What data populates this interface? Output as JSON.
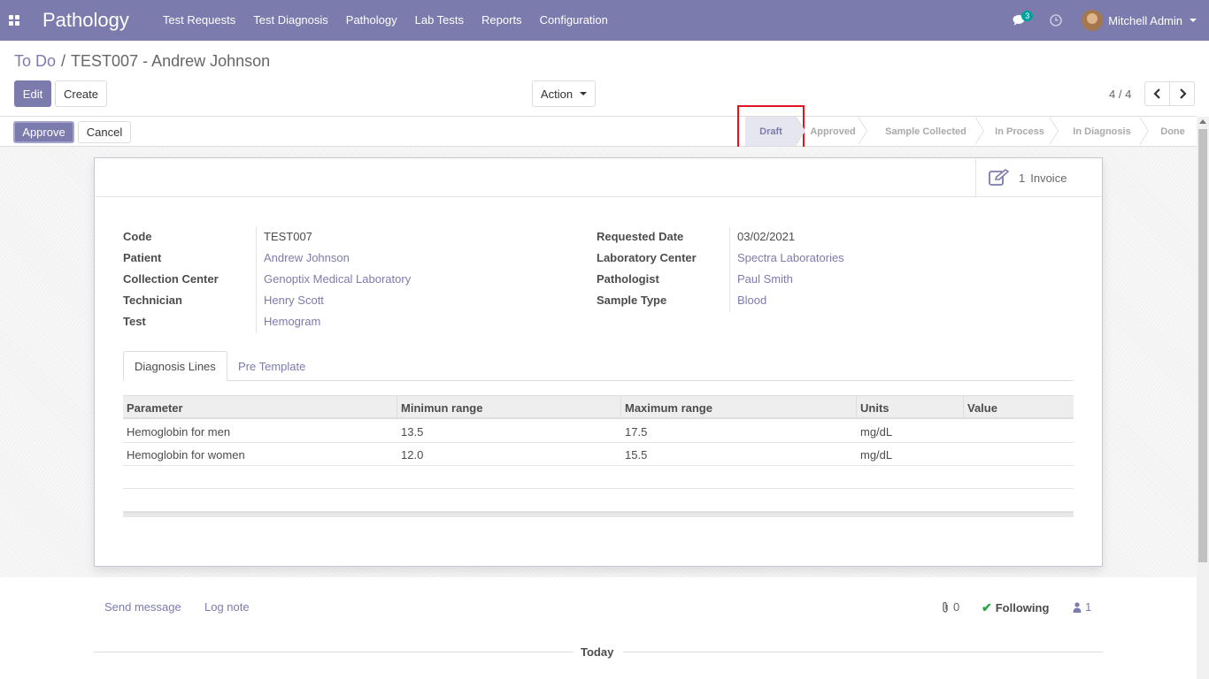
{
  "app": {
    "brand": "Pathology"
  },
  "menu": [
    "Test Requests",
    "Test Diagnosis",
    "Pathology",
    "Lab Tests",
    "Reports",
    "Configuration"
  ],
  "nav": {
    "chat_count": "3",
    "user_name": "Mitchell Admin"
  },
  "breadcrumb": {
    "parent": "To Do",
    "separator": "/",
    "current": "TEST007 - Andrew Johnson"
  },
  "toolbar": {
    "edit_label": "Edit",
    "create_label": "Create",
    "action_label": "Action"
  },
  "pager": {
    "value": "4 / 4"
  },
  "statusbar": {
    "approve_label": "Approve",
    "cancel_label": "Cancel",
    "stages": [
      "Draft",
      "Approved",
      "Sample Collected",
      "In Process",
      "In Diagnosis",
      "Done"
    ],
    "current_stage": "Draft"
  },
  "smart_button": {
    "count": "1",
    "label": "Invoice"
  },
  "fields_left": [
    {
      "label": "Code",
      "value": "TEST007",
      "link": false
    },
    {
      "label": "Patient",
      "value": "Andrew Johnson",
      "link": true
    },
    {
      "label": "Collection Center",
      "value": "Genoptix Medical Laboratory",
      "link": true
    },
    {
      "label": "Technician",
      "value": "Henry Scott",
      "link": true
    },
    {
      "label": "Test",
      "value": "Hemogram",
      "link": true
    }
  ],
  "fields_right": [
    {
      "label": "Requested Date",
      "value": "03/02/2021",
      "link": false
    },
    {
      "label": "Laboratory Center",
      "value": "Spectra Laboratories",
      "link": true
    },
    {
      "label": "Pathologist",
      "value": "Paul Smith",
      "link": true
    },
    {
      "label": "Sample Type",
      "value": "Blood",
      "link": true
    }
  ],
  "tabs": {
    "active": "Diagnosis Lines",
    "inactive": "Pre Template"
  },
  "table": {
    "columns": [
      "Parameter",
      "Minimun range",
      "Maximum range",
      "Units",
      "Value"
    ],
    "rows": [
      [
        "Hemoglobin for men",
        "13.5",
        "17.5",
        "mg/dL",
        ""
      ],
      [
        "Hemoglobin for women",
        "12.0",
        "15.5",
        "mg/dL",
        ""
      ]
    ]
  },
  "chatter": {
    "send_message": "Send message",
    "log_note": "Log note",
    "attachments": "0",
    "following": "Following",
    "followers": "1",
    "today": "Today"
  },
  "colors": {
    "brand": "#7c7bad",
    "highlight": "#e0141e"
  }
}
